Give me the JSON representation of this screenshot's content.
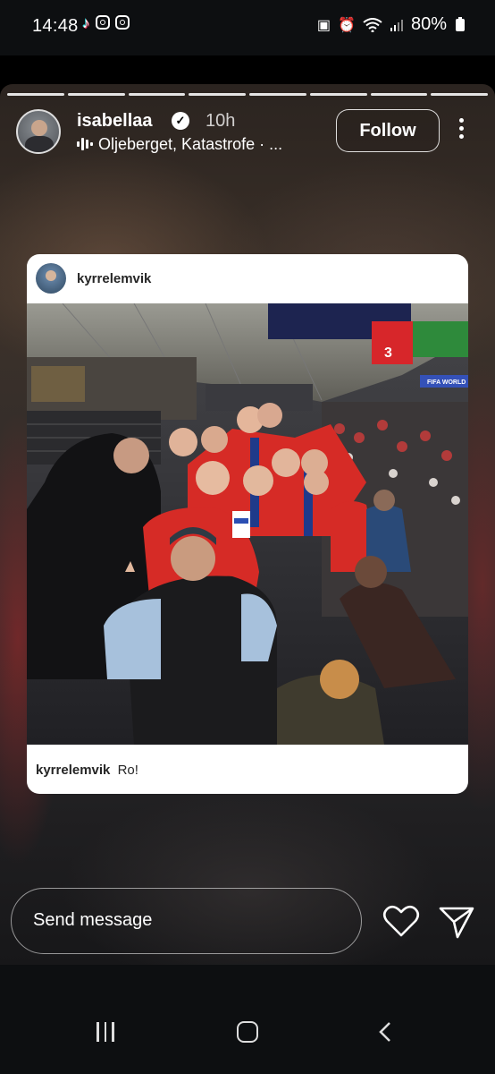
{
  "status_bar": {
    "time": "14:48",
    "battery": "80%"
  },
  "story": {
    "progress_segments": 8,
    "author": {
      "username": "isabellaa",
      "time_ago": "10h",
      "music": "Oljeberget, Katastrofe · ..."
    },
    "follow_label": "Follow",
    "shared_post": {
      "username": "kyrrelemvik",
      "caption_user": "kyrrelemvik",
      "caption_text": "Ro!",
      "scoreboard_number": "3",
      "banner_text": "FIFA WORLD"
    },
    "message_placeholder": "Send message"
  },
  "colors": {
    "card": "#ffffff",
    "jersey_red": "#d62b26",
    "jersey_blue": "#1f3a8a"
  },
  "icons": [
    "tiktok-icon",
    "instagram-icon",
    "instagram-icon",
    "nfc-icon",
    "alarm-icon",
    "wifi-icon",
    "signal-icon",
    "battery-icon",
    "verified-icon",
    "music-icon",
    "more-icon",
    "heart-icon",
    "send-icon",
    "recents-icon",
    "home-icon",
    "back-icon"
  ]
}
